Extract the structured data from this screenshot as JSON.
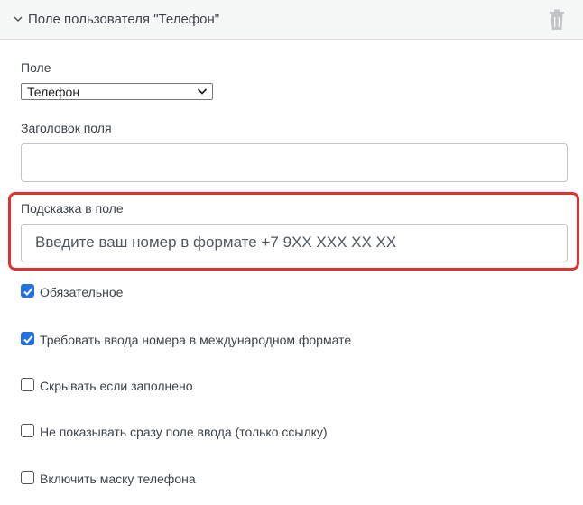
{
  "panel": {
    "title": "Поле пользователя \"Телефон\"",
    "icons": {
      "toggle": "chevron-down-icon",
      "delete": "trash-icon"
    }
  },
  "field": {
    "label": "Поле",
    "selected": "Телефон"
  },
  "title_field": {
    "label": "Заголовок поля",
    "value": ""
  },
  "hint_field": {
    "label": "Подсказка в поле",
    "value": "Введите ваш номер в формате +7 9XX XXX XX XX"
  },
  "options": [
    {
      "label": "Обязательное",
      "checked": true
    },
    {
      "label": "Требовать ввода номера в международном формате",
      "checked": true
    },
    {
      "label": "Скрывать если заполнено",
      "checked": false
    },
    {
      "label": "Не показывать сразу поле ввода (только ссылку)",
      "checked": false
    },
    {
      "label": "Включить маску телефона",
      "checked": false
    }
  ],
  "colors": {
    "accent": "#2271e3",
    "highlight": "#e03131"
  }
}
